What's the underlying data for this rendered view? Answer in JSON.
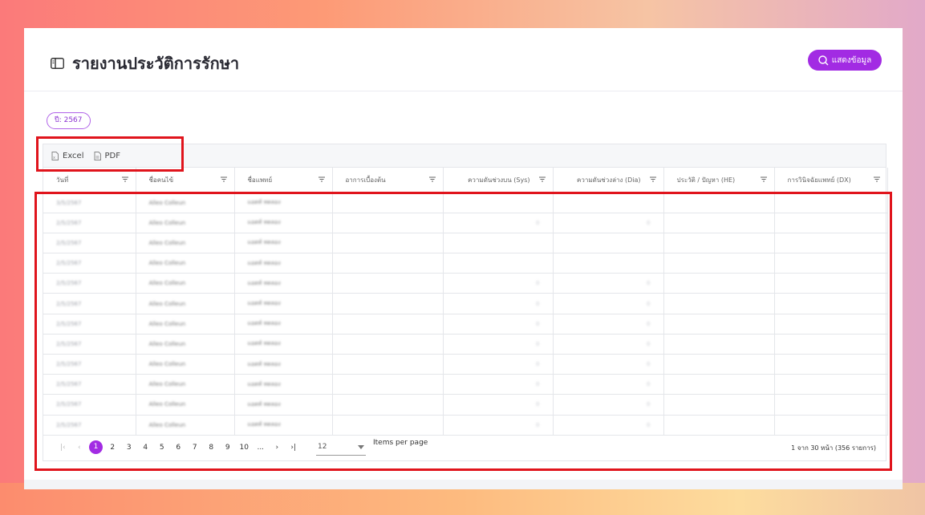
{
  "page": {
    "title": "รายงานประวัติการรักษา",
    "show_button": "แสดงข้อมูล",
    "year_badge": "ปี: 2567"
  },
  "toolbar": {
    "excel": "Excel",
    "pdf": "PDF"
  },
  "columns": [
    "วันที่",
    "ชื่อคนไข้",
    "ชื่อแพทย์",
    "อาการเบื้องต้น",
    "ความดันช่วงบน (Sys)",
    "ความดันช่วงล่าง (Dia)",
    "ประวัติ / ปัญหา (HE)",
    "การวินิจฉัยแพทย์ (DX)"
  ],
  "rows": [
    [
      "3/5/2567",
      "Alleo Colleun",
      "แอดท์ ทดลอง",
      "",
      "",
      "",
      "",
      ""
    ],
    [
      "2/5/2567",
      "Alleo Colleun",
      "แอดท์ ทดลอง",
      "",
      "0",
      "0",
      "",
      ""
    ],
    [
      "2/5/2567",
      "Alleo Colleun",
      "แอดท์ ทดลอง",
      "",
      "",
      "",
      "",
      ""
    ],
    [
      "2/5/2567",
      "Alleo Colleun",
      "แอดท์ ทดลอง",
      "",
      "",
      "",
      "",
      ""
    ],
    [
      "2/5/2567",
      "Alleo Colleun",
      "แอดท์ ทดลอง",
      "",
      "0",
      "0",
      "",
      ""
    ],
    [
      "2/5/2567",
      "Alleo Colleun",
      "แอดท์ ทดลอง",
      "",
      "0",
      "0",
      "",
      ""
    ],
    [
      "2/5/2567",
      "Alleo Colleun",
      "แอดท์ ทดลอง",
      "",
      "0",
      "0",
      "",
      ""
    ],
    [
      "2/5/2567",
      "Alleo Colleun",
      "แอดท์ ทดลอง",
      "",
      "0",
      "0",
      "",
      ""
    ],
    [
      "2/5/2567",
      "Alleo Colleun",
      "แอดท์ ทดลอง",
      "",
      "0",
      "0",
      "",
      ""
    ],
    [
      "2/5/2567",
      "Alleo Colleun",
      "แอดท์ ทดลอง",
      "",
      "0",
      "0",
      "",
      ""
    ],
    [
      "2/5/2567",
      "Alleo Colleun",
      "แอดท์ ทดลอง",
      "",
      "0",
      "0",
      "",
      ""
    ],
    [
      "2/5/2567",
      "Alleo Colleun",
      "แอดท์ ทดลอง",
      "",
      "0",
      "0",
      "",
      ""
    ]
  ],
  "pagination": {
    "first": "|‹",
    "prev": "‹",
    "pages": [
      "1",
      "2",
      "3",
      "4",
      "5",
      "6",
      "7",
      "8",
      "9",
      "10",
      "..."
    ],
    "active_page": "1",
    "next": "›",
    "last": "›|",
    "per_page_value": "12",
    "per_page_label": "Items per page",
    "summary": "1 จาก 30 หน้า (356 รายการ)"
  },
  "colors": {
    "accent": "#a22be3",
    "highlight": "#e0141c"
  }
}
